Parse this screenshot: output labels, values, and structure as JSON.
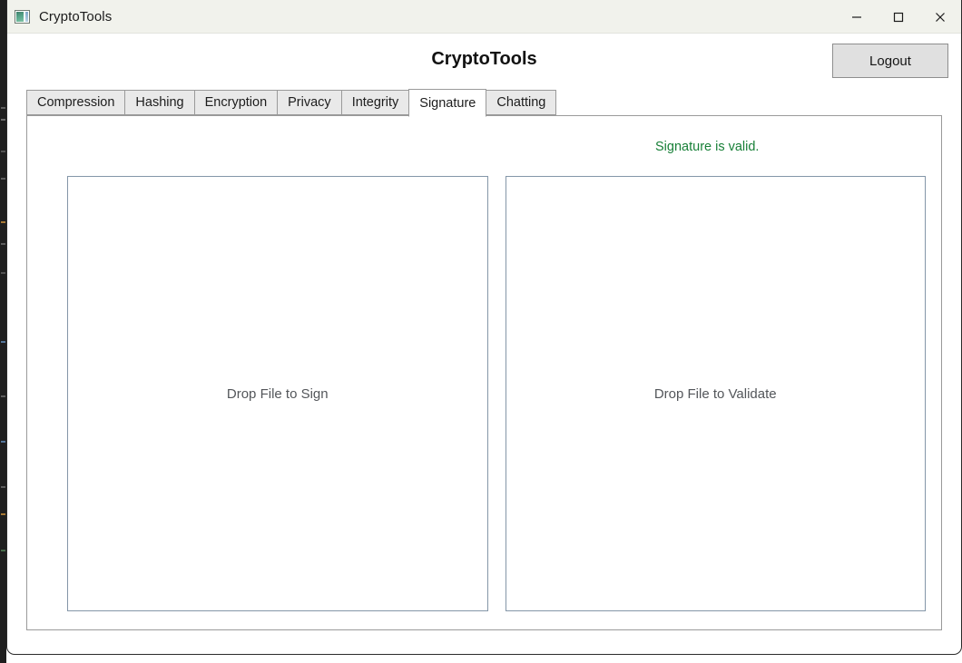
{
  "window": {
    "title": "CryptoTools",
    "icon": "app-image-icon",
    "controls": [
      {
        "name": "minimize",
        "glyph": "minimize-icon"
      },
      {
        "name": "maximize",
        "glyph": "maximize-icon"
      },
      {
        "name": "close",
        "glyph": "close-icon"
      }
    ]
  },
  "header": {
    "title": "CryptoTools",
    "logout_label": "Logout"
  },
  "tabs": [
    {
      "label": "Compression",
      "selected": false
    },
    {
      "label": "Hashing",
      "selected": false
    },
    {
      "label": "Encryption",
      "selected": false
    },
    {
      "label": "Privacy",
      "selected": false
    },
    {
      "label": "Integrity",
      "selected": false
    },
    {
      "label": "Signature",
      "selected": true
    },
    {
      "label": "Chatting",
      "selected": false
    }
  ],
  "signature_panel": {
    "status_text": "Signature is valid.",
    "status_color": "#188038",
    "dropzones": [
      {
        "label": "Drop File to Sign",
        "name": "sign-dropzone"
      },
      {
        "label": "Drop File to Validate",
        "name": "validate-dropzone"
      }
    ]
  },
  "colors": {
    "titlebar_bg": "#f1f2ec",
    "tab_bg": "#e9e9e9",
    "tab_selected_bg": "#ffffff",
    "button_bg": "#e0e0e0",
    "dropzone_border": "#8496a8",
    "panel_border": "#9a9a9a",
    "status_green": "#188038"
  }
}
